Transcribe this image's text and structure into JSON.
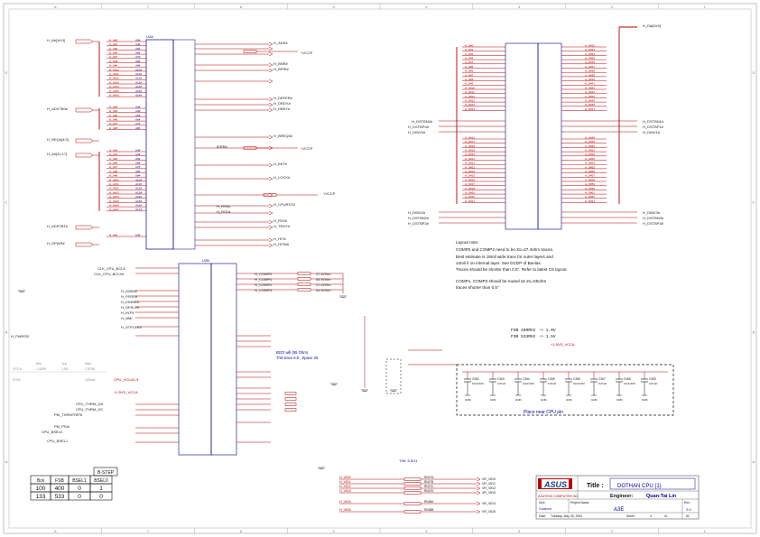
{
  "colors": {
    "wire": "#b00000",
    "part": "#00008b",
    "text": "#222222",
    "frame": "#555555",
    "asus_red": "#c00000",
    "asus_blue": "#1a3b8f"
  },
  "u2a": {
    "ref": "U2A",
    "a_net": "H_A#[16:3]",
    "adstb0_net": "H_ADSTB0#",
    "req_net": "H_REQ#[4:0]",
    "a2_net": "H_A#[31:17]",
    "adstb1_net": "H_ADSTB1#",
    "dpwr_net": "H_DPWR#",
    "ads": "H_ADS#",
    "bnr": "H_BNR#",
    "bpri": "H_BPRI#",
    "defer": "H_DEFER#",
    "drdy": "H_DRDY#",
    "dbsy": "H_DBSY#",
    "breq0": "H_BREQ0#",
    "ierr": "IERR#",
    "init": "H_INIT#",
    "lock": "H_LOCK#",
    "cpurst": "H_CPURST#",
    "rs0": "H_RS0#",
    "rs1": "H_RS1#",
    "rs2": "H_RS2#",
    "trdy": "H_TRDY#",
    "hit": "H_HIT#",
    "hitm": "H_HITM#",
    "vccp": "+VCCP",
    "tp_label": "TP81"
  },
  "u2b": {
    "ref": "U2B",
    "bclk0": "CLK_CPU_BCLK",
    "bclk1": "CLK_CPU_BCLK#",
    "comp0": "H_COMP0",
    "comp1": "H_COMP1",
    "comp2": "H_COMP2",
    "comp3": "H_COMP3",
    "a20m": "H_A20M#",
    "ferr": "H_FERR#",
    "ignne": "H_IGNNE#",
    "dpslp": "H_DPSLP#",
    "intr": "H_INTR",
    "nmi": "H_NMI",
    "stpclk": "H_STPCLK#",
    "pwrgd": "H_PWRGD",
    "prochot": "PM_THRMTRIP#",
    "thermda": "CPU_THRM_DA",
    "thermdc": "CPU_THRM_DC",
    "psi": "CPU_BSEL0",
    "bsel1": "CPU_BSEL1",
    "thrmtrip": "PM_THRMTRIP#",
    "pm_psi": "PM_PSI#",
    "note1": "BGO will (55 Ohm)",
    "note2": "T/W trace 5:5 , Space 25",
    "ccomp": "COMP[0..3]",
    "res1": "27.4Ohm",
    "res2": "54.9Ohm",
    "res3": "1.5KOhm",
    "res4": "680 Ohm"
  },
  "vcc_table": {
    "headers": [
      "",
      "Min",
      "Typ",
      "Max"
    ],
    "rows": [
      [
        "VCCA",
        "1.425V",
        "1.5V",
        "1.575V"
      ],
      [
        "ICCA",
        "",
        "",
        "120mA"
      ]
    ]
  },
  "u2c": {
    "ref": "U2A",
    "dstbn_nets": [
      "H_DSTBN0#",
      "H_DSTBP0#",
      "H_DINV0#"
    ],
    "dstbn2_nets": [
      "H_DINV2#",
      "H_DSTBN2#",
      "H_DSTBP2#"
    ],
    "right_nets": [
      "H_DSTBN1#",
      "H_DSTBP1#",
      "H_DINV1#"
    ],
    "right2_nets": [
      "H_DINV3#",
      "H_DSTBN3#",
      "H_DSTBP3#"
    ],
    "top_net": "H_D#[63:0]",
    "pins": "D[0..63]#"
  },
  "layout_note": {
    "title": "Layout note:",
    "lines": [
      "COMP0 and COMP2 need to be Zo=27.4ohm traces.",
      "Best estimate is 18mil wide trace for outer layers and",
      "14mil if on internal layer. See DCDP of Banias.",
      "Traces should be shorter than 0.5\". Refer to latest CS layout",
      "",
      "COMP1, COMP3 should be routed as Zo=55ohm",
      "traces shorter than 0.5\""
    ]
  },
  "fsb_note": [
    "FSB 400MHz -> 1.0V",
    "FSB 533MHz -> 1.5V"
  ],
  "cap_area": {
    "caption": "Place near CPU pin",
    "net": "+1.5VS_VCCA",
    "gnd": "GND",
    "caps": [
      "C362",
      "C363",
      "C364",
      "C365",
      "C366",
      "C367",
      "C368",
      "C369"
    ],
    "cap_values": [
      "10uF/10V",
      "0.01uF",
      "10uF/10V",
      "0.01uF",
      "10uF/10V",
      "0.01uF",
      "10uF/10V",
      "0.01uF"
    ]
  },
  "vcca_label": "CPU_VCCA1.5",
  "vccq_label": "+1.5VS_VCCA",
  "bsel_table": {
    "title": "B-STEP",
    "headers": [
      "Bck",
      "FSB",
      "BSEL1",
      "BSEL0"
    ],
    "rows": [
      [
        "100",
        "400",
        "0",
        "1"
      ],
      [
        "133",
        "533",
        "0",
        "0"
      ]
    ]
  },
  "bottom_nets": {
    "vid": [
      "H_VID0",
      "H_VID1",
      "H_VID2",
      "H_VID3",
      "H_VID4",
      "H_VID5"
    ],
    "vr": [
      "VR_VID0",
      "VR_VID1",
      "VR_VID2",
      "VR_VID3",
      "VR_VID4",
      "VR_VID5"
    ],
    "rnames": [
      "RN27A",
      "RN27B",
      "RN27C",
      "RN27D",
      "RN28A",
      "RN28B"
    ],
    "note": "T/W: 5.5/11"
  },
  "title_block": {
    "logo": "ASUS",
    "title_label": "Title :",
    "title": "DOTHAN CPU (1)",
    "company": "ASUSTeK COMPUTER INC.",
    "engineer_label": "Engineer:",
    "engineer": "Quan-Tai Lin",
    "size_label": "Size",
    "project_label": "Project Name",
    "rev_label": "Rev",
    "project": "A3E",
    "size": "Custom",
    "rev": "2.0",
    "date_label": "Date:",
    "date": "Tuesday, May 25, 2004",
    "sheet_label": "Sheet",
    "sheet": "3",
    "of_label": "of",
    "sheets": "51"
  },
  "frame_numbers": {
    "top": [
      "8",
      "7",
      "6",
      "5",
      "4",
      "3",
      "2",
      "1"
    ],
    "side": [
      "D",
      "C",
      "B",
      "A"
    ]
  }
}
